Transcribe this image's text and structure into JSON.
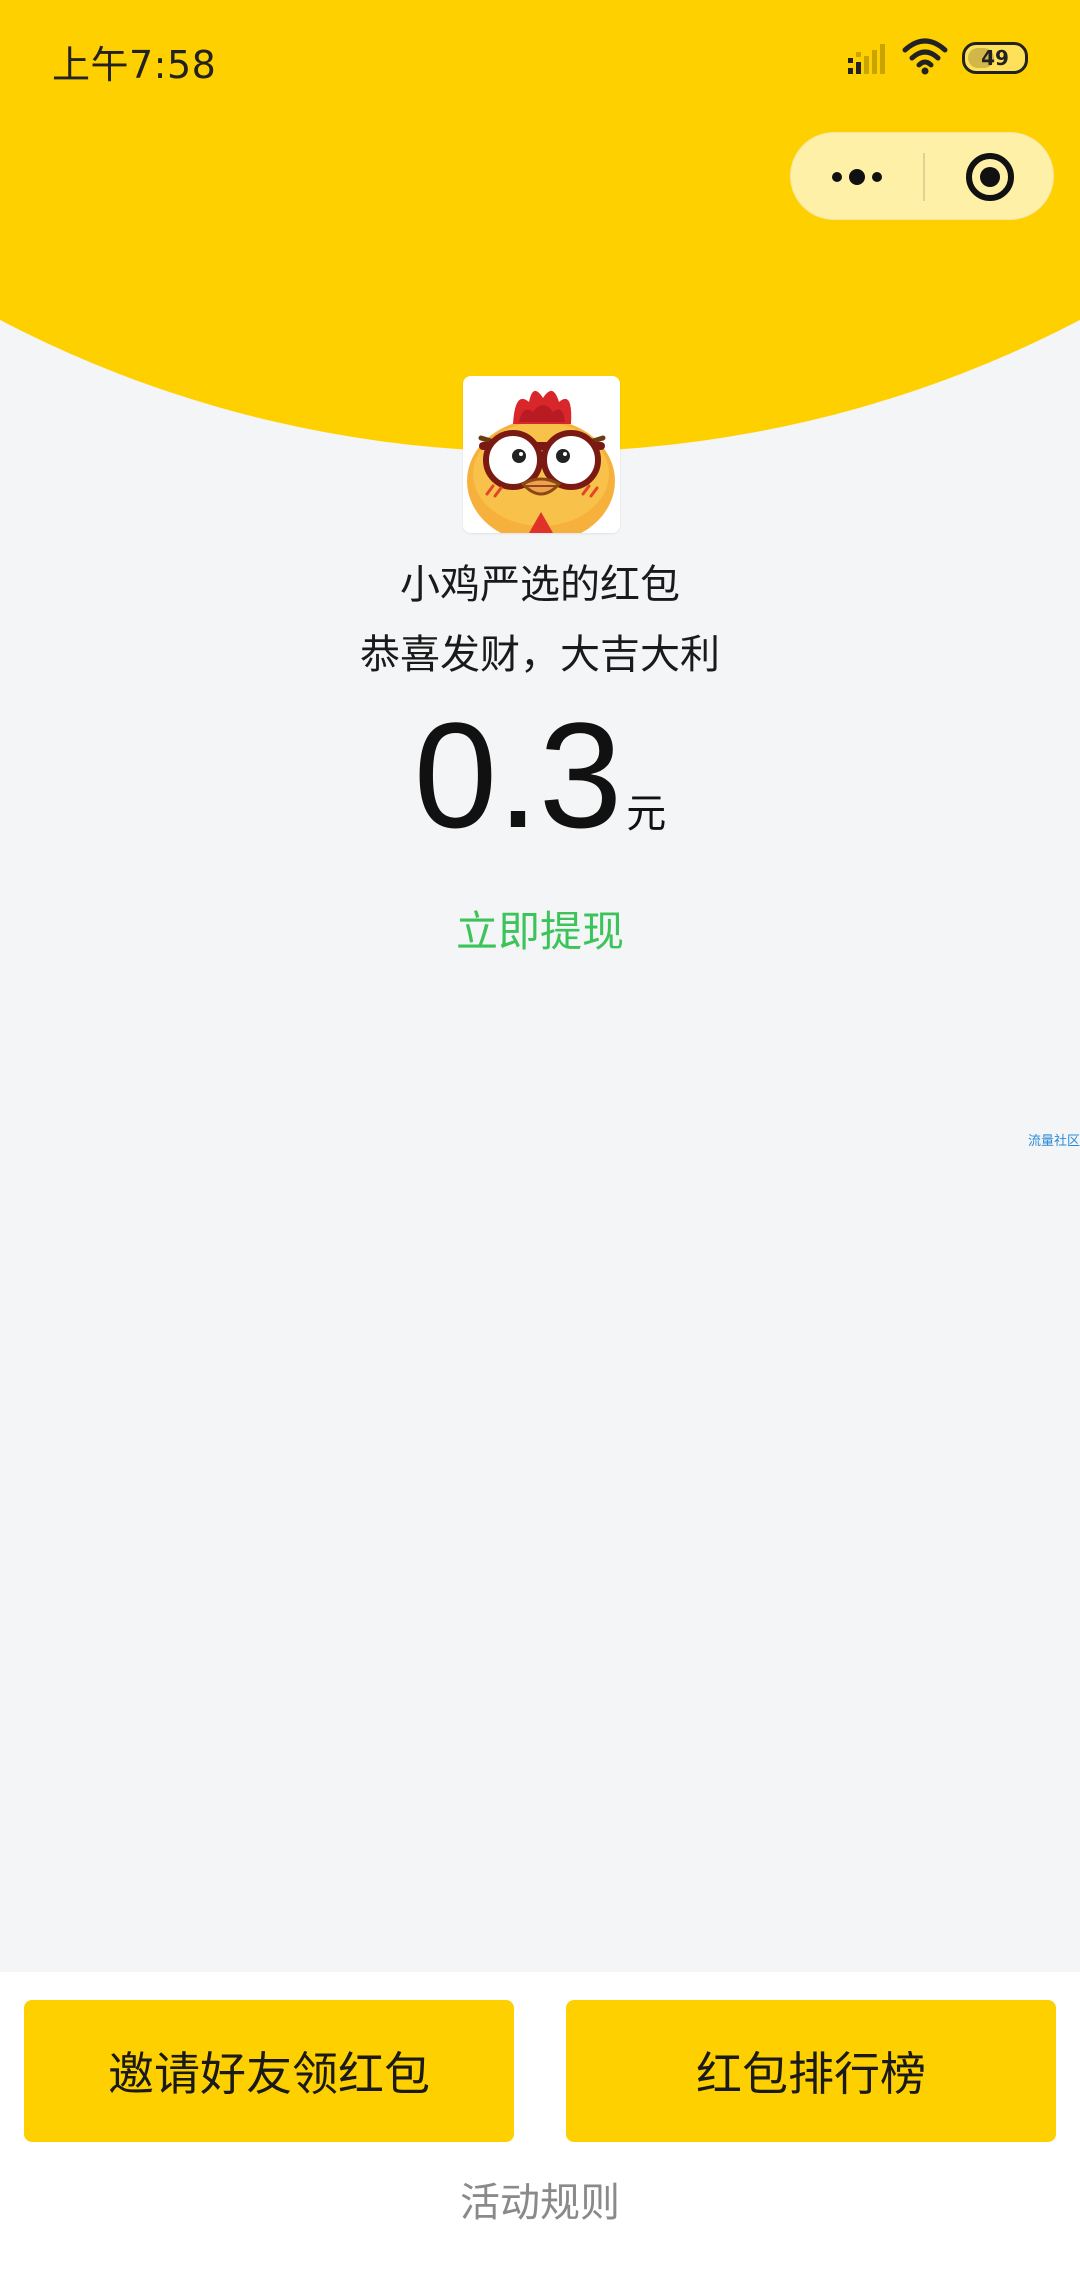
{
  "status_bar": {
    "time": "上午7:58",
    "battery_level": "49",
    "battery_fraction": 0.49,
    "icons": [
      "signal-icon",
      "wifi-icon",
      "battery-icon"
    ]
  },
  "capsule_menu": {
    "more_icon": "more-dots-icon",
    "close_icon": "target-close-icon"
  },
  "red_packet": {
    "avatar_icon": "chicken-avatar-icon",
    "sender_name": "小鸡严选的红包",
    "greeting": "恭喜发财，大吉大利",
    "amount": "0.3",
    "unit": "元",
    "withdraw_label": "立即提现"
  },
  "watermark": "流量社区",
  "bottom": {
    "invite_label": "邀请好友领红包",
    "rank_label": "红包排行榜",
    "rules_label": "活动规则"
  },
  "colors": {
    "brand_yellow": "#ffd000",
    "link_green": "#3cc45a",
    "background": "#f4f5f7"
  }
}
